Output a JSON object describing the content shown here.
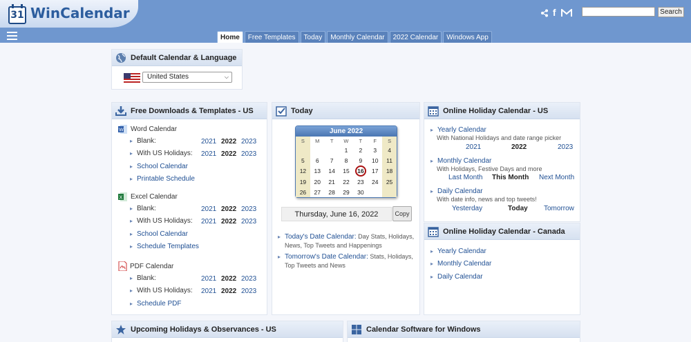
{
  "header": {
    "logo_number": "31",
    "logo_text": "WinCalendar",
    "share_icons": [
      "share-icon",
      "facebook-icon",
      "email-icon"
    ],
    "search": {
      "value": "",
      "button": "Search"
    }
  },
  "tabs": [
    "Home",
    "Free Templates",
    "Today",
    "Monthly Calendar",
    "2022 Calendar",
    "Windows App"
  ],
  "lang_panel": {
    "title": "Default Calendar & Language",
    "selected": "United States"
  },
  "downloads": {
    "title": "Free Downloads & Templates - US",
    "word": {
      "label": "Word Calendar",
      "blank": "Blank:",
      "holidays": "With US Holidays:",
      "school": "School Calendar",
      "printable": "Printable Schedule"
    },
    "excel": {
      "label": "Excel Calendar",
      "blank": "Blank:",
      "holidays": "With US Holidays:",
      "school": "School Calendar",
      "templates": "Schedule Templates"
    },
    "pdf": {
      "label": "PDF Calendar",
      "blank": "Blank:",
      "holidays": "With US Holidays:",
      "schedule": "Schedule PDF"
    },
    "years": [
      "2021",
      "2022",
      "2023"
    ]
  },
  "today": {
    "title": "Today",
    "calendar": {
      "month_title": "June  2022",
      "dow": [
        "S",
        "M",
        "T",
        "W",
        "T",
        "F",
        "S"
      ],
      "weeks": [
        [
          "",
          "",
          "",
          "1",
          "2",
          "3",
          "4"
        ],
        [
          "5",
          "6",
          "7",
          "8",
          "9",
          "10",
          "11"
        ],
        [
          "12",
          "13",
          "14",
          "15",
          "16",
          "17",
          "18"
        ],
        [
          "19",
          "20",
          "21",
          "22",
          "23",
          "24",
          "25"
        ],
        [
          "26",
          "27",
          "28",
          "29",
          "30",
          "",
          ""
        ]
      ],
      "today": "16"
    },
    "date_text": "Thursday, June 16, 2022",
    "copy": "Copy",
    "links": [
      {
        "link": "Today's Date Calendar:",
        "desc": " Day Stats, Holidays,",
        "desc2": "News, Top Tweets and Happenings"
      },
      {
        "link": "Tomorrow's Date Calendar:",
        "desc": " Stats, Holidays,",
        "desc2": "Top Tweets and News"
      }
    ]
  },
  "online_us": {
    "title": "Online Holiday Calendar - US",
    "yearly": {
      "label": "Yearly Calendar",
      "desc": "With National Holidays and date range picker",
      "opts": [
        "2021",
        "2022",
        "2023"
      ]
    },
    "monthly": {
      "label": "Monthly Calendar",
      "desc": "With Holidays, Festive Days and more",
      "opts": [
        "Last Month",
        "This Month",
        "Next Month"
      ]
    },
    "daily": {
      "label": "Daily Calendar",
      "desc": "With date info, news and top tweets!",
      "opts": [
        "Yesterday",
        "Today",
        "Tomorrow"
      ]
    }
  },
  "online_ca": {
    "title": "Online Holiday Calendar - Canada",
    "items": [
      "Yearly Calendar",
      "Monthly Calendar",
      "Daily Calendar"
    ]
  },
  "bottom": {
    "upcoming": "Upcoming Holidays & Observances - US",
    "software": "Calendar Software for Windows"
  }
}
